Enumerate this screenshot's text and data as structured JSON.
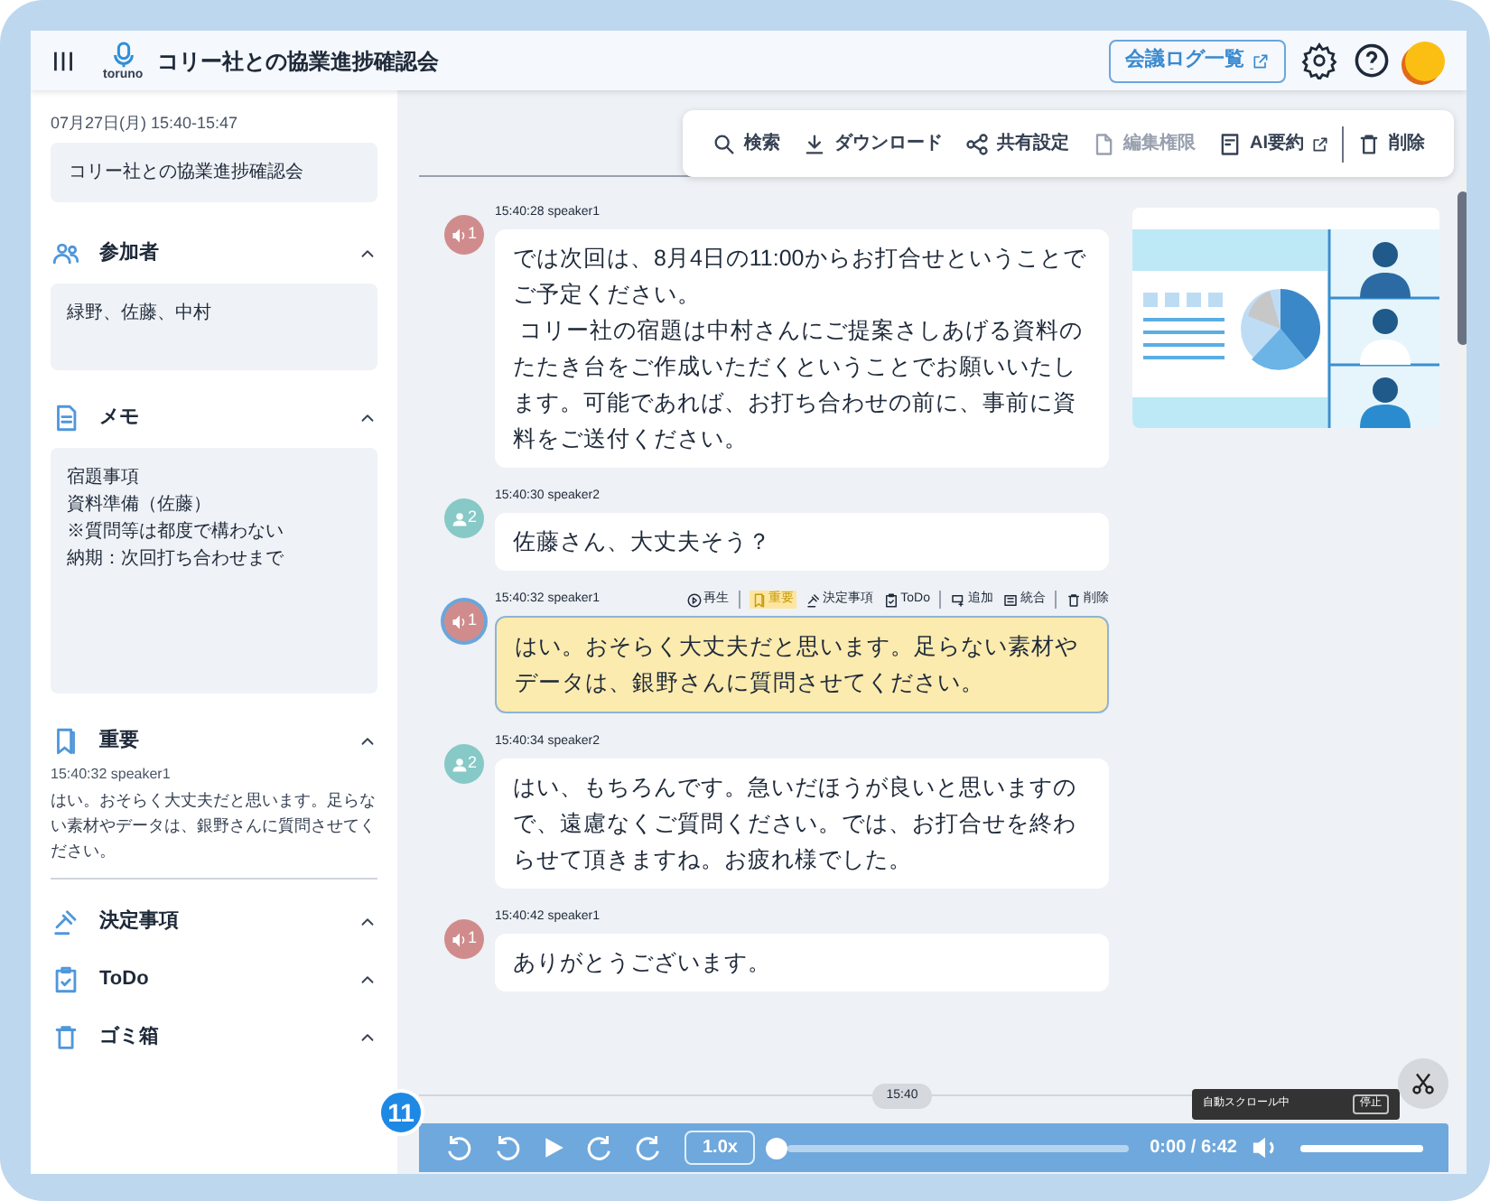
{
  "header": {
    "title": "コリー社との協業進捗確認会",
    "logo_text": "toruno",
    "log_button": "会議ログ一覧"
  },
  "sidebar": {
    "datetime": "07月27日(月) 15:40-15:47",
    "meeting_name": "コリー社との協業進捗確認会",
    "sections": [
      {
        "kind": "box",
        "label": "参加者",
        "expanded": true,
        "lines": [
          "緑野、佐藤、中村"
        ]
      },
      {
        "kind": "box",
        "label": "メモ",
        "expanded": true,
        "lines": [
          "宿題事項",
          "資料準備（佐藤）",
          "※質問等は都度で構わない",
          "納期：次回打ち合わせまで"
        ]
      },
      {
        "kind": "entry",
        "label": "重要",
        "expanded": true,
        "meta": "15:40:32 speaker1",
        "text": "はい。おそらく大丈夫だと思います。足らない素材やデータは、銀野さんに質問させてください。"
      },
      {
        "kind": "empty",
        "label": "決定事項",
        "expanded": true
      },
      {
        "kind": "empty",
        "label": "ToDo",
        "expanded": true
      },
      {
        "kind": "empty",
        "label": "ゴミ箱",
        "expanded": true
      }
    ]
  },
  "toolbar": [
    {
      "label": "検索",
      "disabled": false
    },
    {
      "label": "ダウンロード",
      "disabled": false
    },
    {
      "label": "共有設定",
      "disabled": false
    },
    {
      "label": "編集権限",
      "disabled": true
    },
    {
      "label": "AI要約",
      "disabled": false
    },
    {
      "label": "削除",
      "disabled": false
    }
  ],
  "messages": [
    {
      "kind": "audio",
      "badge": "1",
      "color": "#d08c8c",
      "meta": "15:40:28 speaker1",
      "selected": false,
      "lines": [
        "では次回は、8月4日の11:00からお打合せということでご予定ください。",
        " コリー社の宿題は中村さんにご提案さしあげる資料のたたき台をご作成いただくということでお願いいたします。可能であれば、お打ち合わせの前に、事前に資料をご送付ください。"
      ]
    },
    {
      "kind": "person",
      "badge": "2",
      "color": "#86c9c6",
      "meta": "15:40:30 speaker2",
      "selected": false,
      "lines": [
        "佐藤さん、大丈夫そう？"
      ]
    },
    {
      "kind": "audio",
      "badge": "1",
      "color": "#d08c8c",
      "meta": "15:40:32 speaker1",
      "selected": true,
      "lines": [
        "はい。おそらく大丈夫だと思います。足らない素材やデータは、銀野さんに質問させてください。"
      ]
    },
    {
      "kind": "person",
      "badge": "2",
      "color": "#86c9c6",
      "meta": "15:40:34 speaker2",
      "selected": false,
      "lines": [
        "はい、もちろんです。急いだほうが良いと思いますので、遠慮なくご質問ください。では、お打合せを終わらせて頂きますね。お疲れ様でした。"
      ]
    },
    {
      "kind": "audio",
      "badge": "1",
      "color": "#d08c8c",
      "meta": "15:40:42 speaker1",
      "selected": false,
      "lines": [
        "ありがとうございます。"
      ]
    }
  ],
  "message_actions": [
    "再生",
    "重要",
    "決定事項",
    "ToDo",
    "追加",
    "統合",
    "削除"
  ],
  "timeline_marker": "15:40",
  "autoscroll": {
    "label": "自動スクロール中",
    "button": "停止"
  },
  "step_badge": "11",
  "player": {
    "speed": "1.0x",
    "time": "0:00 / 6:42",
    "progress": {
      "level": 0
    },
    "volume": {
      "level": 1
    }
  }
}
